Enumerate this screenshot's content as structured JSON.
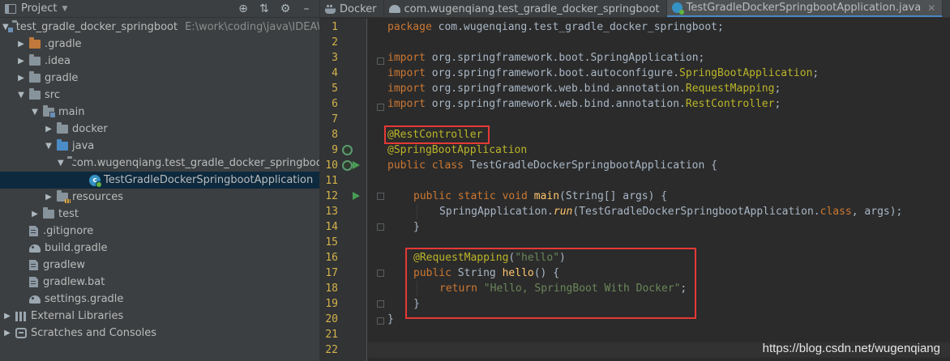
{
  "project_panel": {
    "title": "Project",
    "tree": [
      {
        "label": "test_gradle_docker_springboot",
        "hint": "E:\\work\\coding\\java\\IDEAWo",
        "expanded": "open"
      },
      {
        "label": ".gradle"
      },
      {
        "label": ".idea"
      },
      {
        "label": "gradle"
      },
      {
        "label": "src"
      },
      {
        "label": "main"
      },
      {
        "label": "docker"
      },
      {
        "label": "java"
      },
      {
        "label": "com.wugenqiang.test_gradle_docker_springboot"
      },
      {
        "label": "TestGradleDockerSpringbootApplication"
      },
      {
        "label": "resources"
      },
      {
        "label": "test"
      },
      {
        "label": ".gitignore"
      },
      {
        "label": "build.gradle"
      },
      {
        "label": "gradlew"
      },
      {
        "label": "gradlew.bat"
      },
      {
        "label": "settings.gradle"
      },
      {
        "label": "External Libraries"
      },
      {
        "label": "Scratches and Consoles"
      }
    ]
  },
  "tabs": [
    {
      "label": "Docker"
    },
    {
      "label": "com.wugenqiang.test_gradle_docker_springboot"
    },
    {
      "label": "TestGradleDockerSpringbootApplication.java"
    }
  ],
  "code": {
    "line_numbers": [
      "1",
      "2",
      "3",
      "4",
      "5",
      "6",
      "7",
      "8",
      "9",
      "10",
      "11",
      "12",
      "13",
      "14",
      "15",
      "16",
      "17",
      "18",
      "19",
      "20",
      "21",
      "22"
    ],
    "l1_kw": "package",
    "l1_rest": " com.wugenqiang.test_gradle_docker_springboot;",
    "import_kw": "import",
    "l3": " org.springframework.boot.SpringApplication;",
    "l4_a": " org.springframework.boot.autoconfigure.",
    "l4_b": "SpringBootApplication",
    "l4_c": ";",
    "l5_a": " org.springframework.web.bind.annotation.",
    "l5_b": "RequestMapping",
    "l5_c": ";",
    "l6_a": " org.springframework.web.bind.annotation.",
    "l6_b": "RestController",
    "l6_c": ";",
    "l8": "@RestController",
    "l9": "@SpringBootApplication",
    "l10_kw": "public class",
    "l10_rest": " TestGradleDockerSpringbootApplication {",
    "l12_kw": "public static void",
    "l12_m": " main",
    "l12_rest": "(String[] args) {",
    "l13_a": "SpringApplication.",
    "l13_b": "run",
    "l13_c": "(TestGradleDockerSpringbootApplication.",
    "l13_kw": "class",
    "l13_d": ", args);",
    "close_brace": "}",
    "l16_a": "@RequestMapping",
    "l16_b": "(",
    "l16_str": "\"hello\"",
    "l16_c": ")",
    "l17_kw": "public",
    "l17_a": " String ",
    "l17_m": "hello",
    "l17_b": "() {",
    "l18_kw": "return",
    "l18_str": " \"Hello, SpringBoot With Docker\"",
    "l18_c": ";"
  },
  "watermark": "https://blog.csdn.net/wugenqiang"
}
